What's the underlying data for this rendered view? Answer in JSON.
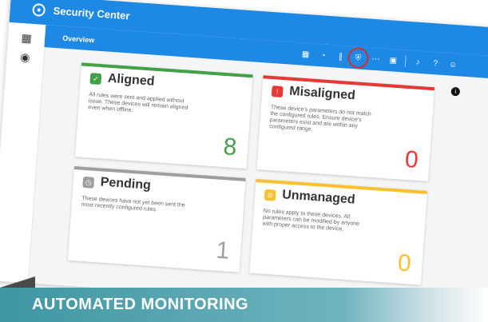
{
  "app": {
    "title": "Security Center"
  },
  "header": {
    "section": "Overview"
  },
  "toolbar": {
    "icons": [
      "dashboard-icon",
      "gauge-icon",
      "columns-icon",
      "shield-icon",
      "devices-icon",
      "report-icon",
      "bell-icon",
      "help-icon",
      "user-icon"
    ],
    "active": "shield-icon"
  },
  "sidebar": {
    "items": [
      "grid-icon",
      "chat-icon"
    ]
  },
  "cards": [
    {
      "title": "Aligned",
      "description": "All rules were sent and applied without issue. These devices will remain aligned even when offline.",
      "count": "8",
      "color": "#43a047"
    },
    {
      "title": "Misaligned",
      "description": "These device's parameters do not match the configured rules. Ensure device's parameters exist and are within any configured range.",
      "count": "0",
      "color": "#e53935"
    },
    {
      "title": "Pending",
      "description": "These devices have not yet been sent the most recently configured rules.",
      "count": "1",
      "color": "#9e9e9e"
    },
    {
      "title": "Unmanaged",
      "description": "No rules apply to these devices. All parameters can be modified by anyone with proper access to the device.",
      "count": "0",
      "color": "#fbc02d"
    }
  ],
  "banner": {
    "text": "AUTOMATED MONITORING"
  }
}
